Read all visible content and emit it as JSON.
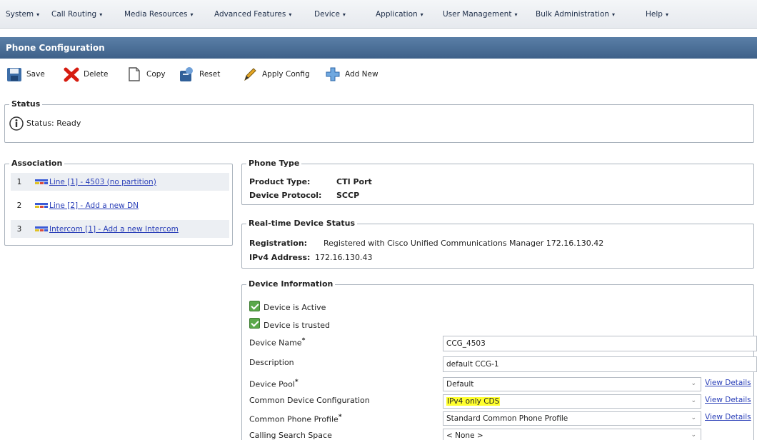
{
  "menu": [
    "System",
    "Call Routing",
    "Media Resources",
    "Advanced Features",
    "Device",
    "Application",
    "User Management",
    "Bulk Administration",
    "Help"
  ],
  "menu_arrow": "▾",
  "title": "Phone Configuration",
  "toolbar": {
    "save": "Save",
    "delete": "Delete",
    "copy": "Copy",
    "reset": "Reset",
    "apply": "Apply Config",
    "add": "Add New"
  },
  "status": {
    "legend": "Status",
    "text": "Status: Ready"
  },
  "association": {
    "legend": "Association",
    "items": [
      {
        "num": "1",
        "label": "Line [1] - 4503 (no partition)"
      },
      {
        "num": "2",
        "label": "Line [2] - Add a new DN"
      },
      {
        "num": "3",
        "label": "Intercom [1] - Add a new Intercom"
      }
    ]
  },
  "phone_type": {
    "legend": "Phone Type",
    "product_label": "Product Type:",
    "product_value": "CTI Port",
    "protocol_label": "Device Protocol:",
    "protocol_value": "SCCP"
  },
  "realtime": {
    "legend": "Real-time Device Status",
    "reg_label": "Registration:",
    "reg_value": "Registered with Cisco Unified Communications Manager 172.16.130.42",
    "ip_label": "IPv4 Address:",
    "ip_value": "172.16.130.43"
  },
  "device_info": {
    "legend": "Device Information",
    "active_label": "Device is Active",
    "trusted_label": "Device is trusted",
    "name_label": "Device Name",
    "name_value": "CCG_4503",
    "desc_label": "Description",
    "desc_value": "default CCG-1",
    "pool_label": "Device Pool",
    "pool_value": "Default",
    "common_cfg_label": "Common Device Configuration",
    "common_cfg_value": "IPv4 only CDS",
    "profile_label": "Common Phone Profile",
    "profile_value": "Standard Common Phone Profile",
    "css_label": "Calling Search Space",
    "css_value": "< None >",
    "view_details": "View Details",
    "required_mark": "*"
  },
  "colors": {
    "title_bar": "#4a6c94",
    "link": "#2a3fb8",
    "highlight": "#ffff2e",
    "check": "#5aa84a"
  }
}
